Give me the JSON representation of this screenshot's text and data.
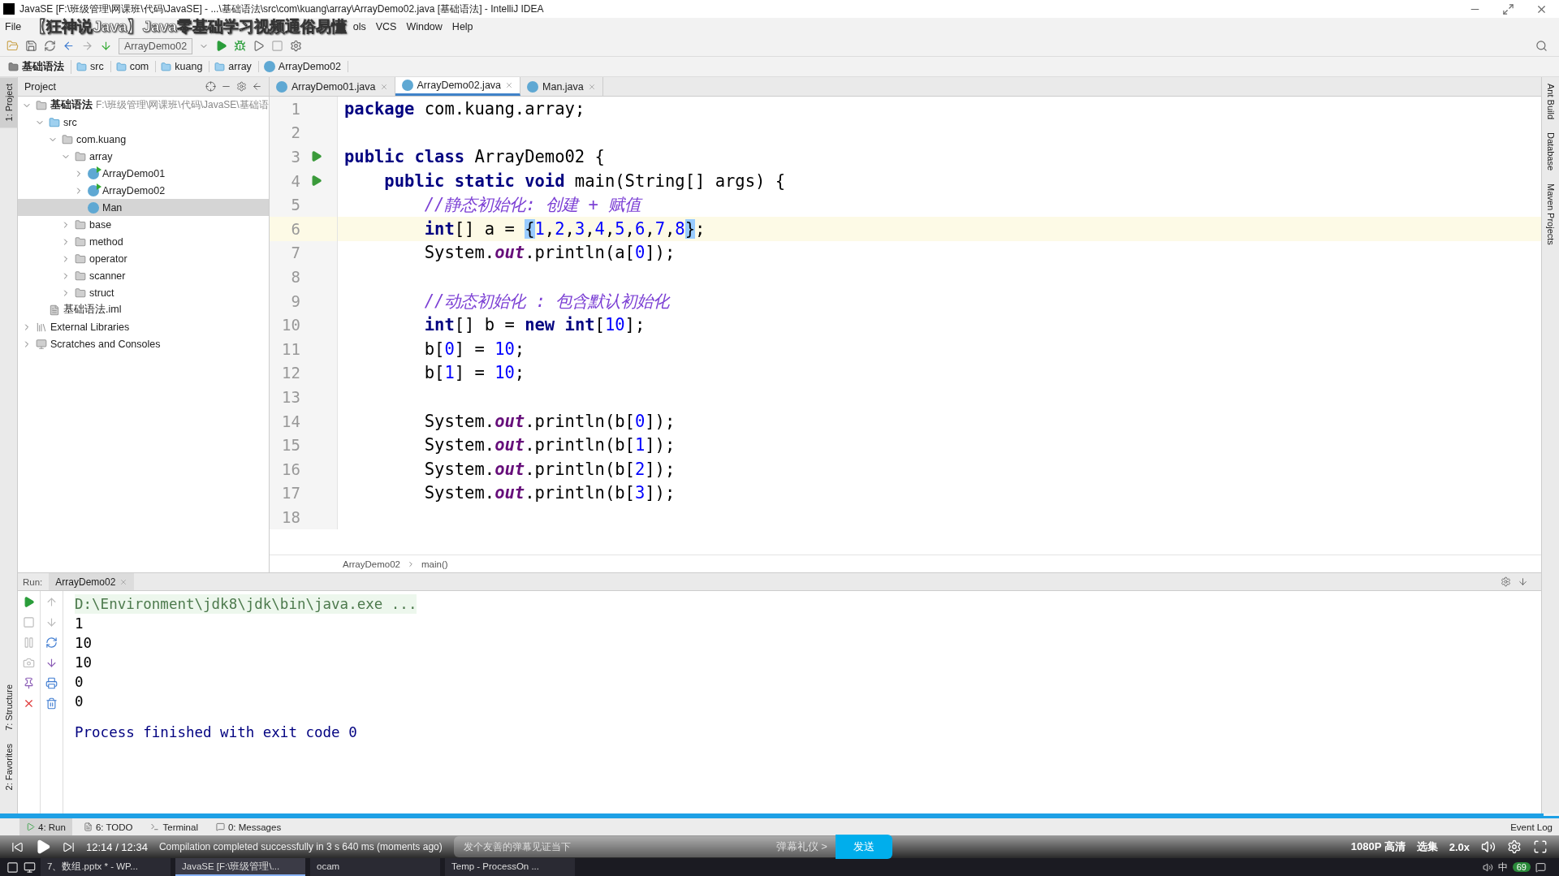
{
  "window": {
    "title": "JavaSE [F:\\班级管理\\网课班\\代码\\JavaSE] - ...\\基础语法\\src\\com\\kuang\\array\\ArrayDemo02.java [基础语法] - IntelliJ IDEA"
  },
  "video_title": "【狂神说Java】Java零基础学习视频通俗易懂",
  "menu": [
    "File",
    "ols",
    "VCS",
    "Window",
    "Help"
  ],
  "toolbar": {
    "run_config": "ArrayDemo02"
  },
  "breadcrumbs": [
    {
      "label": "基础语法",
      "kind": "module"
    },
    {
      "label": "src",
      "kind": "folder"
    },
    {
      "label": "com",
      "kind": "folder"
    },
    {
      "label": "kuang",
      "kind": "folder"
    },
    {
      "label": "array",
      "kind": "folder"
    },
    {
      "label": "ArrayDemo02",
      "kind": "class"
    }
  ],
  "left_stripe": [
    {
      "label": "1: Project",
      "selected": true
    },
    {
      "label": "7: Structure",
      "selected": false
    },
    {
      "label": "2: Favorites",
      "selected": false
    }
  ],
  "right_stripe": [
    {
      "label": "Ant Build",
      "selected": false
    },
    {
      "label": "Database",
      "selected": false
    },
    {
      "label": "Maven Projects",
      "selected": false
    }
  ],
  "project_panel": {
    "title": "Project",
    "tree": [
      {
        "label": "基础语法",
        "path": "F:\\班级管理\\网课班\\代码\\JavaSE\\基础语",
        "kind": "module",
        "expanded": true,
        "selected": false,
        "children": [
          {
            "label": "src",
            "kind": "source",
            "expanded": true,
            "selected": false,
            "children": [
              {
                "label": "com.kuang",
                "kind": "folder",
                "expanded": true,
                "selected": false,
                "children": [
                  {
                    "label": "array",
                    "kind": "folder",
                    "expanded": true,
                    "selected": false,
                    "children": [
                      {
                        "label": "ArrayDemo01",
                        "kind": "runclass",
                        "expanded": false,
                        "selected": false
                      },
                      {
                        "label": "ArrayDemo02",
                        "kind": "runclass",
                        "expanded": false,
                        "selected": false
                      },
                      {
                        "label": "Man",
                        "kind": "class",
                        "selected": true
                      }
                    ]
                  },
                  {
                    "label": "base",
                    "kind": "folder",
                    "expanded": false,
                    "selected": false
                  },
                  {
                    "label": "method",
                    "kind": "folder",
                    "expanded": false,
                    "selected": false
                  },
                  {
                    "label": "operator",
                    "kind": "folder",
                    "expanded": false,
                    "selected": false
                  },
                  {
                    "label": "scanner",
                    "kind": "folder",
                    "expanded": false,
                    "selected": false
                  },
                  {
                    "label": "struct",
                    "kind": "folder",
                    "expanded": false,
                    "selected": false
                  }
                ]
              }
            ]
          },
          {
            "label": "基础语法.iml",
            "kind": "file",
            "selected": false
          }
        ]
      },
      {
        "label": "External Libraries",
        "kind": "library",
        "expanded": false,
        "selected": false
      },
      {
        "label": "Scratches and Consoles",
        "kind": "scratch",
        "expanded": false,
        "selected": false
      }
    ]
  },
  "editor_tabs": [
    {
      "label": "ArrayDemo01.java",
      "selected": false
    },
    {
      "label": "ArrayDemo02.java",
      "selected": true
    },
    {
      "label": "Man.java",
      "selected": false
    }
  ],
  "editor": {
    "lines": [
      {
        "number": "1",
        "current": false,
        "run": false,
        "tokens": [
          {
            "kind": "keyword",
            "text": "package"
          },
          {
            "kind": "plain",
            "text": " com.kuang.array;"
          }
        ]
      },
      {
        "number": "2",
        "current": false,
        "run": false
      },
      {
        "number": "3",
        "current": false,
        "run": true,
        "tokens": [
          {
            "kind": "keyword",
            "text": "public class"
          },
          {
            "kind": "plain",
            "text": " ArrayDemo02 {"
          }
        ]
      },
      {
        "number": "4",
        "current": false,
        "run": true,
        "tokens": [
          {
            "kind": "keyword",
            "text": "    public static void"
          },
          {
            "kind": "plain",
            "text": " main(String[] args) {"
          }
        ]
      },
      {
        "number": "5",
        "current": false,
        "run": false,
        "tokens": [
          {
            "kind": "comment",
            "text": "        //静态初始化: 创建 + 赋值"
          }
        ]
      },
      {
        "number": "6",
        "current": true,
        "run": false,
        "tokens": [
          {
            "kind": "keyword",
            "text": "        int"
          },
          {
            "kind": "plain",
            "text": "[] a = "
          },
          {
            "kind": "brace",
            "text": "{"
          },
          {
            "kind": "number",
            "text": "1"
          },
          {
            "kind": "plain",
            "text": ","
          },
          {
            "kind": "number",
            "text": "2"
          },
          {
            "kind": "plain",
            "text": ","
          },
          {
            "kind": "number",
            "text": "3"
          },
          {
            "kind": "plain",
            "text": ","
          },
          {
            "kind": "number",
            "text": "4"
          },
          {
            "kind": "plain",
            "text": ","
          },
          {
            "kind": "number",
            "text": "5"
          },
          {
            "kind": "plain",
            "text": ","
          },
          {
            "kind": "number",
            "text": "6"
          },
          {
            "kind": "plain",
            "text": ","
          },
          {
            "kind": "number",
            "text": "7"
          },
          {
            "kind": "plain",
            "text": ","
          },
          {
            "kind": "number",
            "text": "8"
          },
          {
            "kind": "brace",
            "text": "}"
          },
          {
            "kind": "plain",
            "text": ";"
          }
        ]
      },
      {
        "number": "7",
        "current": false,
        "run": false,
        "tokens": [
          {
            "kind": "plain",
            "text": "        System."
          },
          {
            "kind": "field",
            "text": "out"
          },
          {
            "kind": "plain",
            "text": ".println(a["
          },
          {
            "kind": "number",
            "text": "0"
          },
          {
            "kind": "plain",
            "text": "]);"
          }
        ]
      },
      {
        "number": "8",
        "current": false,
        "run": false
      },
      {
        "number": "9",
        "current": false,
        "run": false,
        "tokens": [
          {
            "kind": "comment",
            "text": "        //动态初始化 : 包含默认初始化"
          }
        ]
      },
      {
        "number": "10",
        "current": false,
        "run": false,
        "tokens": [
          {
            "kind": "keyword",
            "text": "        int"
          },
          {
            "kind": "plain",
            "text": "[] b = "
          },
          {
            "kind": "keyword",
            "text": "new int"
          },
          {
            "kind": "plain",
            "text": "["
          },
          {
            "kind": "number",
            "text": "10"
          },
          {
            "kind": "plain",
            "text": "];"
          }
        ]
      },
      {
        "number": "11",
        "current": false,
        "run": false,
        "tokens": [
          {
            "kind": "plain",
            "text": "        b["
          },
          {
            "kind": "number",
            "text": "0"
          },
          {
            "kind": "plain",
            "text": "] = "
          },
          {
            "kind": "number",
            "text": "10"
          },
          {
            "kind": "plain",
            "text": ";"
          }
        ]
      },
      {
        "number": "12",
        "current": false,
        "run": false,
        "tokens": [
          {
            "kind": "plain",
            "text": "        b["
          },
          {
            "kind": "number",
            "text": "1"
          },
          {
            "kind": "plain",
            "text": "] = "
          },
          {
            "kind": "number",
            "text": "10"
          },
          {
            "kind": "plain",
            "text": ";"
          }
        ]
      },
      {
        "number": "13",
        "current": false,
        "run": false
      },
      {
        "number": "14",
        "current": false,
        "run": false,
        "tokens": [
          {
            "kind": "plain",
            "text": "        System."
          },
          {
            "kind": "field",
            "text": "out"
          },
          {
            "kind": "plain",
            "text": ".println(b["
          },
          {
            "kind": "number",
            "text": "0"
          },
          {
            "kind": "plain",
            "text": "]);"
          }
        ]
      },
      {
        "number": "15",
        "current": false,
        "run": false,
        "tokens": [
          {
            "kind": "plain",
            "text": "        System."
          },
          {
            "kind": "field",
            "text": "out"
          },
          {
            "kind": "plain",
            "text": ".println(b["
          },
          {
            "kind": "number",
            "text": "1"
          },
          {
            "kind": "plain",
            "text": "]);"
          }
        ]
      },
      {
        "number": "16",
        "current": false,
        "run": false,
        "tokens": [
          {
            "kind": "plain",
            "text": "        System."
          },
          {
            "kind": "field",
            "text": "out"
          },
          {
            "kind": "plain",
            "text": ".println(b["
          },
          {
            "kind": "number",
            "text": "2"
          },
          {
            "kind": "plain",
            "text": "]);"
          }
        ]
      },
      {
        "number": "17",
        "current": false,
        "run": false,
        "tokens": [
          {
            "kind": "plain",
            "text": "        System."
          },
          {
            "kind": "field",
            "text": "out"
          },
          {
            "kind": "plain",
            "text": ".println(b["
          },
          {
            "kind": "number",
            "text": "3"
          },
          {
            "kind": "plain",
            "text": "]);"
          }
        ]
      },
      {
        "number": "18",
        "current": false,
        "run": false
      }
    ],
    "breadcrumb": [
      "ArrayDemo02",
      "main()"
    ]
  },
  "run_panel": {
    "label": "Run:",
    "tab": "ArrayDemo02",
    "output": [
      {
        "kind": "command",
        "text": "D:\\Environment\\jdk8\\jdk\\bin\\java.exe ..."
      },
      {
        "kind": "out",
        "text": "1"
      },
      {
        "kind": "out",
        "text": "10"
      },
      {
        "kind": "out",
        "text": "10"
      },
      {
        "kind": "out",
        "text": "0"
      },
      {
        "kind": "out",
        "text": "0"
      },
      {
        "kind": "exit",
        "text": "Process finished with exit code 0"
      }
    ]
  },
  "tool_windows": [
    {
      "label": "4: Run",
      "selected": true
    },
    {
      "label": "6: TODO",
      "selected": false
    },
    {
      "label": "Terminal",
      "selected": false
    },
    {
      "label": "0: Messages",
      "selected": false
    }
  ],
  "event_log": "Event Log",
  "video_bar": {
    "progress": {
      "level": 0.99
    },
    "time": "12:14 / 12:34",
    "status": "Compilation completed successfully in 3 s 640 ms (moments ago)",
    "danmaku_placeholder": "发个友善的弹幕见证当下",
    "etiquette": "弹幕礼仪 >",
    "send": "发送",
    "quality": "1080P 高清",
    "episodes": "选集",
    "speed": "2.0x"
  },
  "taskbar": {
    "tasks": [
      {
        "label": "7、数组.pptx * - WP...",
        "selected": false
      },
      {
        "label": "JavaSE [F:\\班级管理\\...",
        "selected": true
      },
      {
        "label": "ocam",
        "selected": false
      },
      {
        "label": "Temp - ProcessOn ...",
        "selected": false
      }
    ],
    "ime": "中",
    "badge": "69"
  }
}
